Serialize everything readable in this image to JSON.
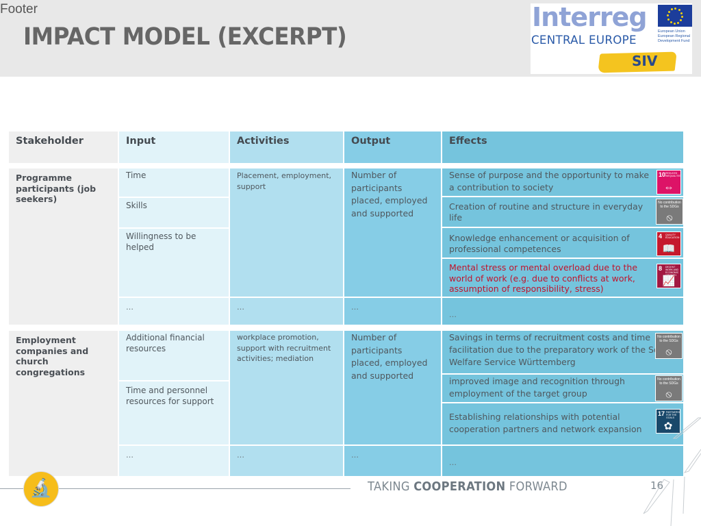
{
  "header": {
    "footer_label": "Footer",
    "title": "IMPACT MODEL (EXCERPT)",
    "logo": {
      "wordmark": "Interreg",
      "subtitle": "CENTRAL EUROPE",
      "eu_text": [
        "European Union",
        "European Regional",
        "Development Fund"
      ],
      "project": "SIV",
      "icon": "eu-flag-icon"
    }
  },
  "table": {
    "columns": [
      "Stakeholder",
      "Input",
      "Activities",
      "Output",
      "Effects"
    ],
    "groups": [
      {
        "stakeholder": "Programme participants (job seekers)",
        "inputs": [
          "Time",
          "Skills",
          "Willingness to be helped",
          "…"
        ],
        "activities": [
          "Placement, employment, support",
          "…"
        ],
        "outputs": [
          "Number of participants placed, employed and supported",
          "…"
        ],
        "effects": [
          {
            "text": "Sense of purpose and the opportunity to make a contribution to society",
            "sdg": {
              "number": "10",
              "label": "REDUCED INEQUALITIES",
              "color": "#dd1367",
              "icon": "reduced-inequalities-icon"
            }
          },
          {
            "text": "Creation of routine and structure in everyday life",
            "sdg": {
              "number": "",
              "label": "No contribution to the SDGs",
              "color": "#7a7a7a",
              "icon": "no-contribution-icon"
            }
          },
          {
            "text": "Knowledge enhancement or acquisition of professional competences",
            "sdg": {
              "number": "4",
              "label": "QUALITY EDUCATION",
              "color": "#c5192d",
              "icon": "quality-education-icon"
            }
          },
          {
            "text": "Mental stress or mental overload due to the world of work (e.g. due to conflicts at work, assumption of responsibility, stress)",
            "negative": true,
            "sdg": {
              "number": "8",
              "label": "DECENT WORK AND ECONOMIC GROWTH",
              "color": "#a21942",
              "icon": "decent-work-icon"
            }
          },
          {
            "text": "…"
          }
        ]
      },
      {
        "stakeholder": "Employment companies and church congregations",
        "inputs": [
          "Additional financial resources",
          "Time and personnel resources for support",
          "…"
        ],
        "activities": [
          "workplace promotion, support with recruitment activities; mediation",
          "…"
        ],
        "outputs": [
          "Number of participants placed, employed and supported",
          "…"
        ],
        "effects": [
          {
            "text": "Savings in terms of recruitment costs and time facilitation due to the preparatory work of the Social Welfare Service Württemberg",
            "sdg": {
              "number": "",
              "label": "No contribution to the SDGs",
              "color": "#7a7a7a",
              "icon": "no-contribution-icon"
            }
          },
          {
            "text": "improved image and recognition through employment of the target group",
            "sdg": {
              "number": "",
              "label": "No contribution to the SDGs",
              "color": "#7a7a7a",
              "icon": "no-contribution-icon"
            }
          },
          {
            "text": "Establishing relationships with potential cooperation partners and network expansion",
            "sdg": {
              "number": "17",
              "label": "PARTNERSHIPS FOR THE GOALS",
              "color": "#19486a",
              "icon": "partnerships-icon"
            }
          },
          {
            "text": "…"
          }
        ]
      }
    ]
  },
  "footer": {
    "tagline_pre": "TAKING ",
    "tagline_bold": "COOPERATION",
    "tagline_post": " FORWARD",
    "page_number": "16",
    "badge_icon": "microscope-icon"
  },
  "colors": {
    "stakeholder": "#efefef",
    "input": "#e1f3f9",
    "activities": "#b1dfef",
    "output": "#86cde6",
    "effects": "#75c4dd",
    "negative_text": "#c0142c",
    "badge": "#f6bd1a"
  }
}
